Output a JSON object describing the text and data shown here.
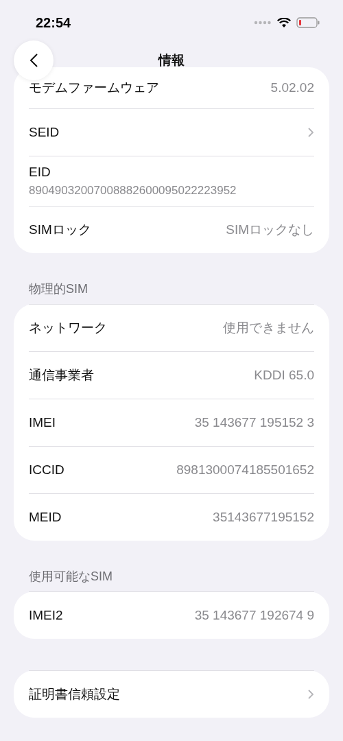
{
  "status_bar": {
    "time": "22:54"
  },
  "nav": {
    "title": "情報"
  },
  "sections": [
    {
      "rows": [
        {
          "kind": "value",
          "label": "モデムファームウェア",
          "value": "5.02.02"
        },
        {
          "kind": "link",
          "label": "SEID"
        },
        {
          "kind": "stacked",
          "label": "EID",
          "value": "89049032007008882600095022223952"
        },
        {
          "kind": "value",
          "label": "SIMロック",
          "value": "SIMロックなし"
        }
      ]
    },
    {
      "header": "物理的SIM",
      "rows": [
        {
          "kind": "value",
          "label": "ネットワーク",
          "value": "使用できません"
        },
        {
          "kind": "value",
          "label": "通信事業者",
          "value": "KDDI 65.0"
        },
        {
          "kind": "value",
          "label": "IMEI",
          "value": "35 143677 195152 3"
        },
        {
          "kind": "value",
          "label": "ICCID",
          "value": "8981300074185501652"
        },
        {
          "kind": "value",
          "label": "MEID",
          "value": "35143677195152"
        }
      ]
    },
    {
      "header": "使用可能なSIM",
      "rows": [
        {
          "kind": "value",
          "label": "IMEI2",
          "value": "35 143677 192674 9"
        }
      ]
    },
    {
      "rows": [
        {
          "kind": "link",
          "label": "証明書信頼設定"
        }
      ]
    }
  ]
}
